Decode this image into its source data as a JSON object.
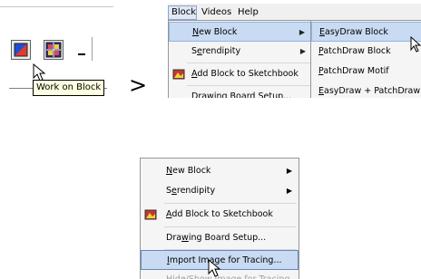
{
  "left_toolbar": {
    "tooltip": "Work on Block",
    "buttons": [
      {
        "icon": "quilt-block-icon"
      },
      {
        "icon": "grid-quilt-icon"
      },
      {
        "icon": "dropdown-arrow-icon"
      }
    ]
  },
  "transition_arrow": ">",
  "top_menu": {
    "menubar": [
      "Block",
      "Videos",
      "Help"
    ],
    "block_menu": [
      {
        "label": "New Block",
        "accel": "N",
        "submenu": true,
        "highlighted": true
      },
      {
        "label": "Serendipity",
        "accel": "e",
        "submenu": true
      },
      {
        "label": "Add Block to Sketchbook",
        "accel": "A",
        "icon": "sketchbook-icon"
      },
      {
        "label": "Drawing Board Setup...",
        "accel": "w"
      }
    ],
    "new_block_submenu": [
      {
        "label": "EasyDraw Block",
        "accel": "E",
        "highlighted": true
      },
      {
        "label": "PatchDraw Block",
        "accel": "P"
      },
      {
        "label": "PatchDraw Motif",
        "accel": "P"
      },
      {
        "label": "EasyDraw + PatchDraw",
        "accel": "E"
      }
    ]
  },
  "bottom_menu": {
    "items": [
      {
        "label": "New Block",
        "accel": "N",
        "submenu": true
      },
      {
        "label": "Serendipity",
        "accel": "e",
        "submenu": true
      },
      {
        "label": "Add Block to Sketchbook",
        "accel": "A",
        "icon": "sketchbook-icon"
      },
      {
        "label": "Drawing Board Setup...",
        "accel": "w"
      },
      {
        "label": "Import Image for Tracing...",
        "accel": "I",
        "highlighted": true
      },
      {
        "label": "Hide/Show Image for Tracing",
        "accel": "",
        "disabled": true
      }
    ]
  },
  "colors": {
    "menu_bg": "#f5f5f5",
    "highlight": "#c8dbf3",
    "tooltip_bg": "#ffffe1"
  }
}
